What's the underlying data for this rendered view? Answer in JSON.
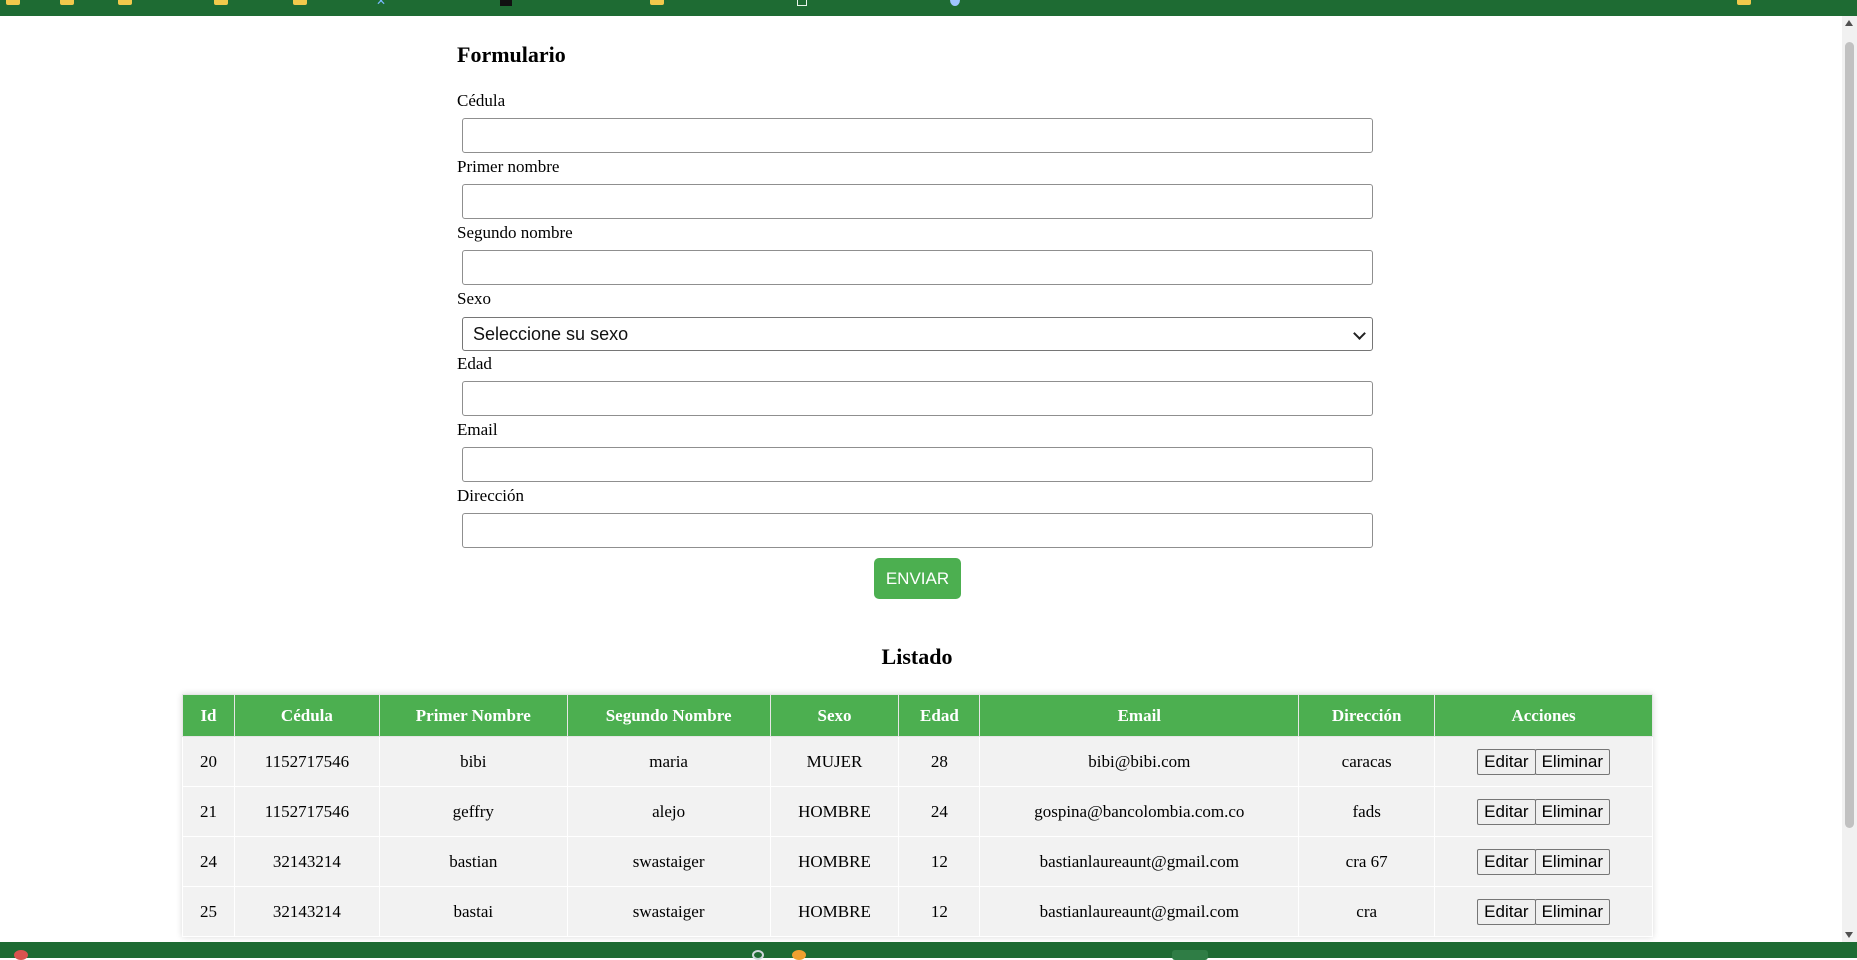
{
  "form": {
    "title": "Formulario",
    "fields": {
      "cedula": {
        "label": "Cédula",
        "value": ""
      },
      "primer_nombre": {
        "label": "Primer nombre",
        "value": ""
      },
      "segundo_nombre": {
        "label": "Segundo nombre",
        "value": ""
      },
      "sexo": {
        "label": "Sexo",
        "selected": "Seleccione su sexo"
      },
      "edad": {
        "label": "Edad",
        "value": ""
      },
      "email": {
        "label": "Email",
        "value": ""
      },
      "direccion": {
        "label": "Dirección",
        "value": ""
      }
    },
    "submit_label": "ENVIAR"
  },
  "list": {
    "title": "Listado",
    "columns": [
      "Id",
      "Cédula",
      "Primer Nombre",
      "Segundo Nombre",
      "Sexo",
      "Edad",
      "Email",
      "Dirección",
      "Acciones"
    ],
    "rows": [
      {
        "id": "20",
        "cedula": "1152717546",
        "primer_nombre": "bibi",
        "segundo_nombre": "maria",
        "sexo": "MUJER",
        "edad": "28",
        "email": "bibi@bibi.com",
        "direccion": "caracas"
      },
      {
        "id": "21",
        "cedula": "1152717546",
        "primer_nombre": "geffry",
        "segundo_nombre": "alejo",
        "sexo": "HOMBRE",
        "edad": "24",
        "email": "gospina@bancolombia.com.co",
        "direccion": "fads"
      },
      {
        "id": "24",
        "cedula": "32143214",
        "primer_nombre": "bastian",
        "segundo_nombre": "swastaiger",
        "sexo": "HOMBRE",
        "edad": "12",
        "email": "bastianlaureaunt@gmail.com",
        "direccion": "cra 67"
      },
      {
        "id": "25",
        "cedula": "32143214",
        "primer_nombre": "bastai",
        "segundo_nombre": "swastaiger",
        "sexo": "HOMBRE",
        "edad": "12",
        "email": "bastianlaureaunt@gmail.com",
        "direccion": "cra"
      }
    ],
    "actions": {
      "edit_label": "Editar",
      "delete_label": "Eliminar"
    }
  },
  "colors": {
    "accent": "#4caf50",
    "browser_bar": "#1e6b33",
    "row_bg": "#f2f2f2"
  }
}
